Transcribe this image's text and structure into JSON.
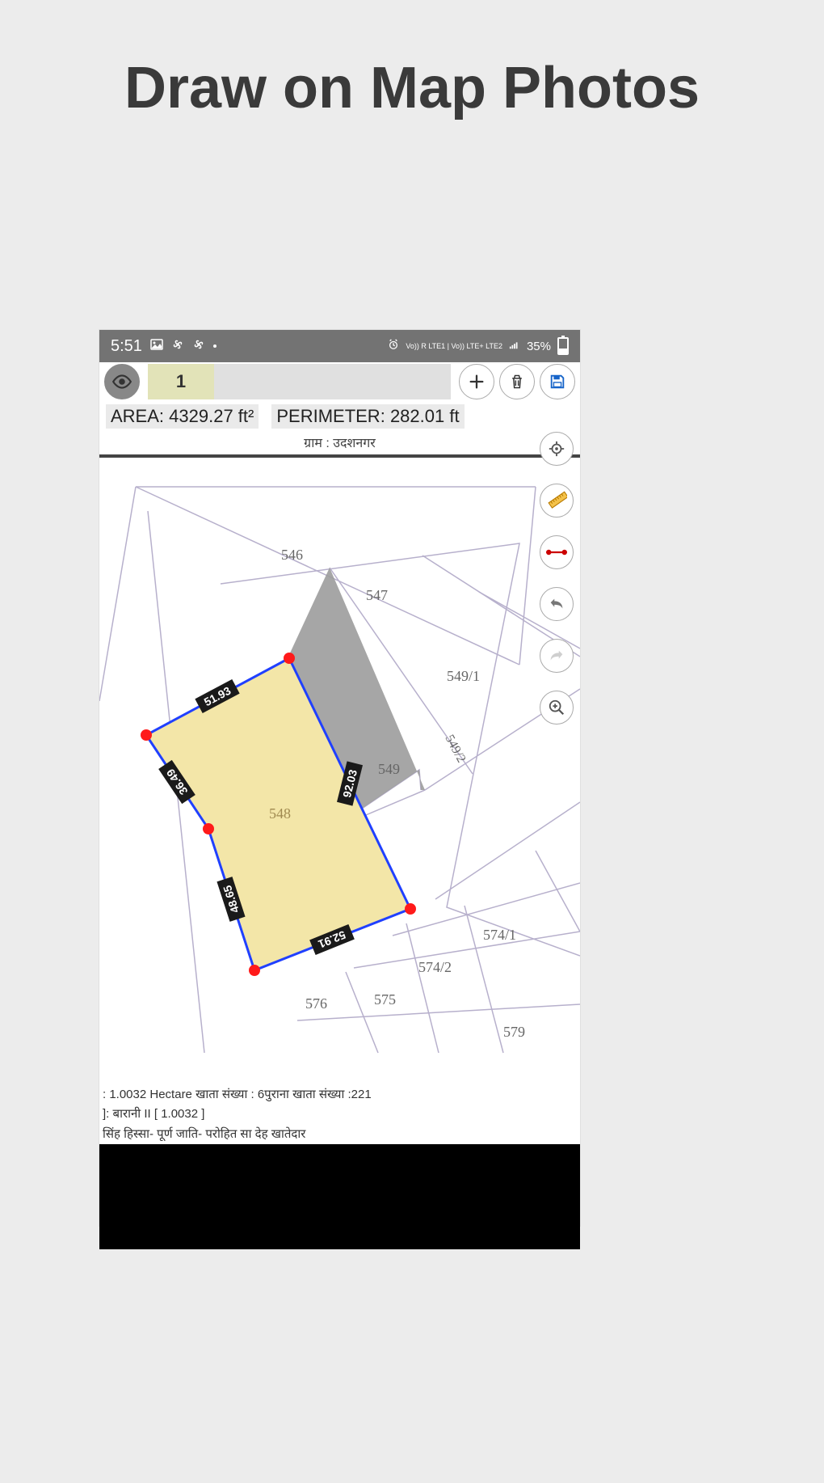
{
  "page": {
    "title": "Draw on Map Photos"
  },
  "statusbar": {
    "time": "5:51",
    "network": "Vo)) R LTE1 | Vo)) LTE+ LTE2",
    "battery_pct": "35%"
  },
  "toolbar": {
    "active_tab": "1"
  },
  "stats": {
    "area_label": "AREA:",
    "area_value": "4329.27 ft²",
    "perimeter_label": "PERIMETER:",
    "perimeter_value": "282.01 ft"
  },
  "map": {
    "header": "ग्राम : उदशनगर",
    "plots": {
      "p546": "546",
      "p547": "547",
      "p548": "548",
      "p549": "549",
      "p549_1": "549/1",
      "p549_2": "549/2",
      "p574_1": "574/1",
      "p574_2": "574/2",
      "p575": "575",
      "p576": "576",
      "p579": "579"
    },
    "edges": {
      "e1": "51.93",
      "e2": "92.03",
      "e3": "52.91",
      "e4": "48.65",
      "e5": "36.49"
    }
  },
  "footer": {
    "line1": ": 1.0032 Hectare  खाता संख्या   : 6पुराना खाता संख्या   :221",
    "line2": "]: बारानी II [ 1.0032 ]",
    "line3": "सिंह हिस्सा- पूर्ण जाति- परोहित सा देह खातेदार"
  }
}
